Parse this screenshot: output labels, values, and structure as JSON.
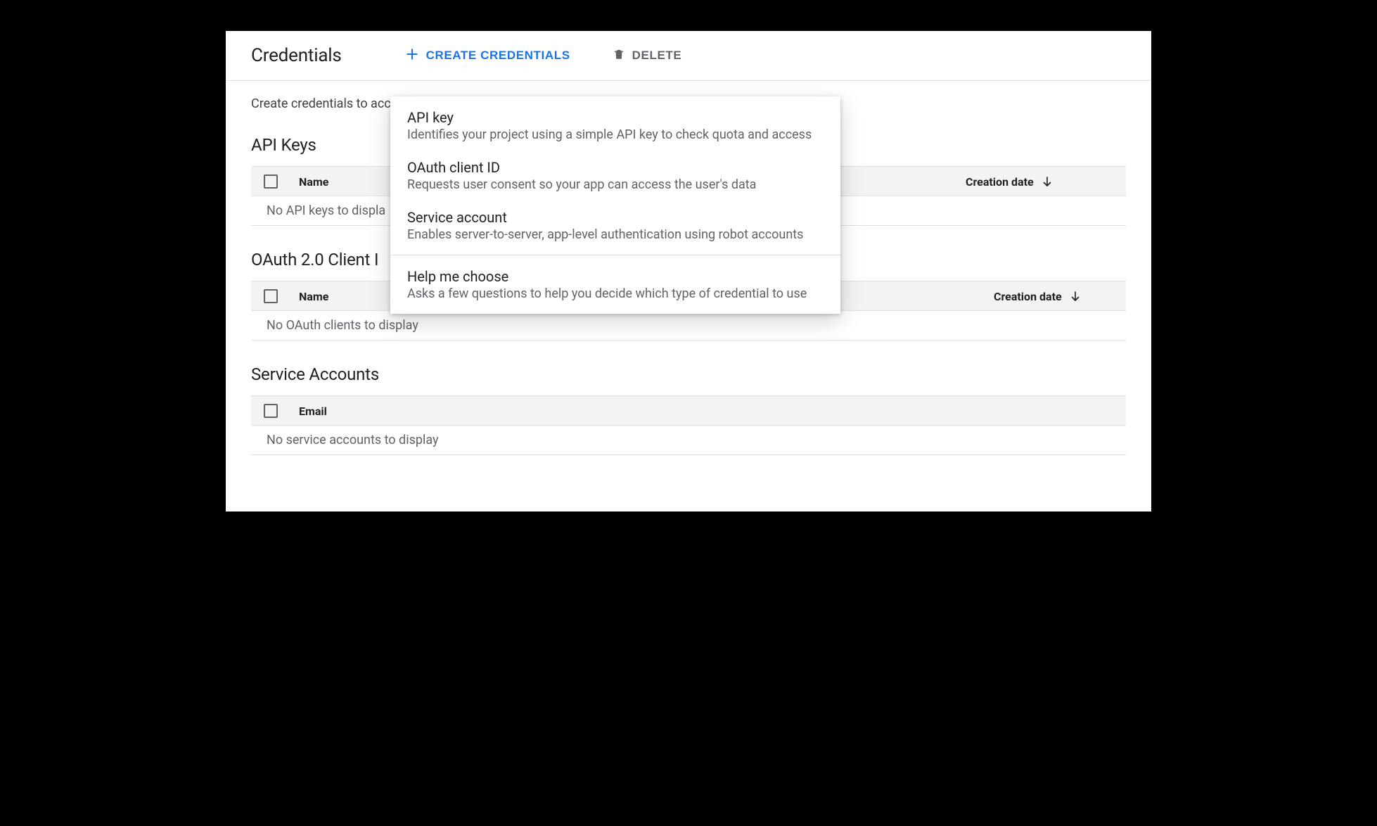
{
  "header": {
    "title": "Credentials",
    "create_label": "CREATE CREDENTIALS",
    "delete_label": "DELETE"
  },
  "intro": "Create credentials to acc",
  "sections": {
    "api_keys": {
      "title": "API Keys",
      "columns": {
        "name": "Name",
        "creation_date": "Creation date"
      },
      "empty": "No API keys to displa"
    },
    "oauth": {
      "title": "OAuth 2.0 Client I",
      "columns": {
        "name": "Name",
        "creation_date": "Creation date"
      },
      "empty": "No OAuth clients to display"
    },
    "service_accounts": {
      "title": "Service Accounts",
      "columns": {
        "email": "Email"
      },
      "empty": "No service accounts to display"
    }
  },
  "menu": {
    "items": [
      {
        "title": "API key",
        "desc": "Identifies your project using a simple API key to check quota and access"
      },
      {
        "title": "OAuth client ID",
        "desc": "Requests user consent so your app can access the user's data"
      },
      {
        "title": "Service account",
        "desc": "Enables server-to-server, app-level authentication using robot accounts"
      }
    ],
    "help": {
      "title": "Help me choose",
      "desc": "Asks a few questions to help you decide which type of credential to use"
    }
  }
}
